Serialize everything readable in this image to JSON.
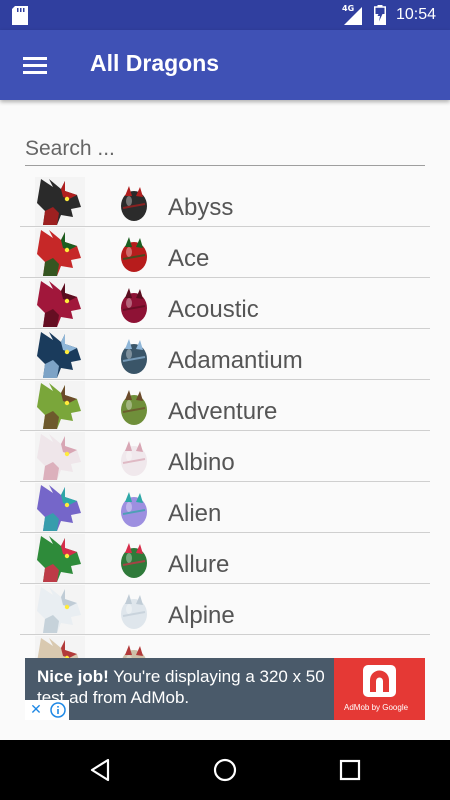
{
  "status_bar": {
    "network": "4G",
    "time": "10:54"
  },
  "app_bar": {
    "title": "All Dragons"
  },
  "search": {
    "placeholder": "Search ..."
  },
  "dragons": [
    {
      "name": "Abyss",
      "primary": "#2a2a2a",
      "secondary": "#b11e1e",
      "egg": "#2b2b2b"
    },
    {
      "name": "Ace",
      "primary": "#c62828",
      "secondary": "#1b5e20",
      "egg": "#b71c1c"
    },
    {
      "name": "Acoustic",
      "primary": "#a1173b",
      "secondary": "#5a0d1f",
      "egg": "#8e1235"
    },
    {
      "name": "Adamantium",
      "primary": "#1a3b5c",
      "secondary": "#8fb6d8",
      "egg": "#3a5568"
    },
    {
      "name": "Adventure",
      "primary": "#7aa63a",
      "secondary": "#6b4b2a",
      "egg": "#6f8f3a"
    },
    {
      "name": "Albino",
      "primary": "#efe6ea",
      "secondary": "#d8a6b4",
      "egg": "#f0e8ec"
    },
    {
      "name": "Alien",
      "primary": "#7566c9",
      "secondary": "#2ea7a7",
      "egg": "#9d8fe0"
    },
    {
      "name": "Allure",
      "primary": "#2e8b3a",
      "secondary": "#d62d4a",
      "egg": "#2f7a3a"
    },
    {
      "name": "Alpine",
      "primary": "#e9eef2",
      "secondary": "#c0ccd6",
      "egg": "#dfe6ec"
    },
    {
      "name": "",
      "primary": "#d9c9b0",
      "secondary": "#b23a3a",
      "egg": "#cdbfa8"
    }
  ],
  "ad": {
    "headline": "Nice job!",
    "body": "You're displaying a 320 x 50 test ad from AdMob.",
    "brand": "AdMob by Google",
    "close_icon": "close-icon",
    "info_icon": "info-icon"
  },
  "nav_bar": {
    "back_icon": "back-icon",
    "home_icon": "home-icon",
    "recents_icon": "recents-icon"
  }
}
